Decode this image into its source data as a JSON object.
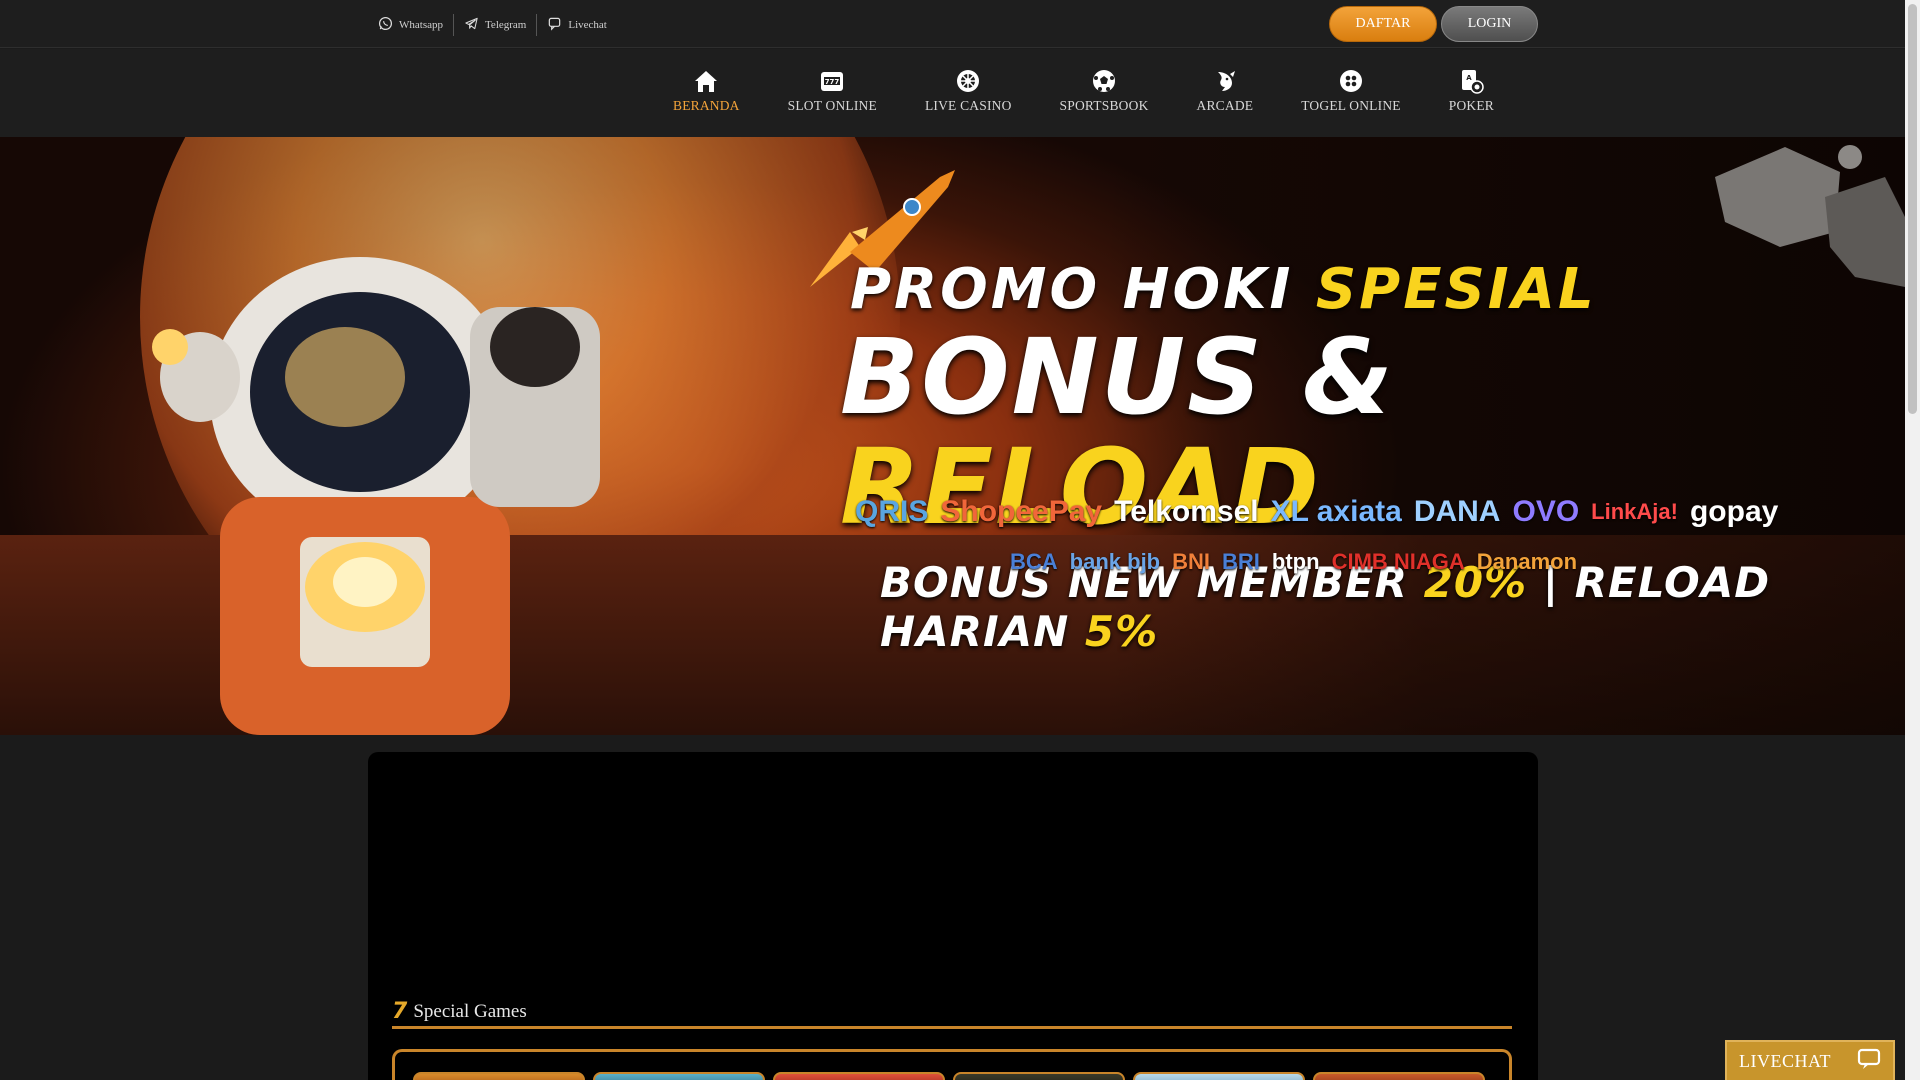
{
  "topbar": {
    "contacts": [
      {
        "label": "Whatsapp",
        "icon": "whatsapp-icon"
      },
      {
        "label": "Telegram",
        "icon": "telegram-icon"
      },
      {
        "label": "Livechat",
        "icon": "chat-icon"
      }
    ],
    "daftar_label": "DAFTAR",
    "login_label": "LOGIN"
  },
  "nav": {
    "items": [
      {
        "label": "BERANDA",
        "icon": "home-icon",
        "active": true
      },
      {
        "label": "SLOT ONLINE",
        "icon": "slot-machine-icon"
      },
      {
        "label": "LIVE CASINO",
        "icon": "roulette-icon"
      },
      {
        "label": "SPORTSBOOK",
        "icon": "soccer-ball-icon"
      },
      {
        "label": "ARCADE",
        "icon": "fish-icon"
      },
      {
        "label": "TOGEL ONLINE",
        "icon": "lottery-ball-icon"
      },
      {
        "label": "POKER",
        "icon": "poker-chip-icon"
      }
    ],
    "active_color": "#f3a33a"
  },
  "banner": {
    "line1_a": "PROMO HOKI",
    "line1_b": "SPESIAL",
    "line2_a": "BONUS &",
    "line2_b": "RELOAD",
    "line3_a": "BONUS NEW  MEMBER",
    "line3_b": "20%",
    "line3_c": " | RELOAD HARIAN",
    "line3_d": "5%",
    "payments_row1": [
      "QRIS",
      "ShopeePay",
      "Telkomsel",
      "XL axiata",
      "DANA",
      "OVO",
      "LinkAja!",
      "gopay"
    ],
    "payments_row2": [
      "BCA",
      "bank bjb",
      "BNI",
      "BRI",
      "btpn",
      "CIMB NIAGA",
      "Danamon"
    ]
  },
  "main": {
    "special_icon": "7",
    "special_title": "Special Games"
  },
  "livechat": {
    "label": "LIVECHAT",
    "icon": "chat-bubble-icon"
  },
  "colors": {
    "accent": "#f3a33a",
    "gold_text": "#f9d31e",
    "frame": "#c9852a",
    "livechat_bg": "#c8952c"
  }
}
